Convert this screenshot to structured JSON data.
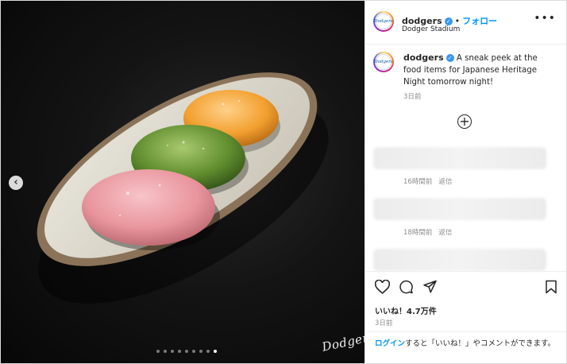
{
  "post": {
    "username": "dodgers",
    "follow_label": "フォロー",
    "location": "Dodger Stadium",
    "more_icon": "more-horizontal-icon",
    "avatar_text": "Dodgers"
  },
  "caption": {
    "username": "dodgers",
    "text": "A sneak peek at the food items for Japanese Heritage Night tomorrow night!",
    "time": "3日前"
  },
  "comments": [
    {
      "time": "16時間前",
      "reply": "返信"
    },
    {
      "time": "18時間前",
      "reply": "返信"
    }
  ],
  "media": {
    "watermark": "Dodgers",
    "carousel_total": 9,
    "carousel_active": 9,
    "prev_icon": "chevron-left-icon"
  },
  "engagement": {
    "likes": "いいね！4.7万件",
    "time": "3日前"
  },
  "login": {
    "link": "ログイン",
    "rest": "すると「いいね！」やコメントができます。"
  },
  "colors": {
    "accent": "#0095f6",
    "verified": "#3897f0",
    "pink_mochi": "#f0a3aa",
    "green_mochi": "#6b9a3a",
    "orange_mochi": "#f4a23a"
  }
}
